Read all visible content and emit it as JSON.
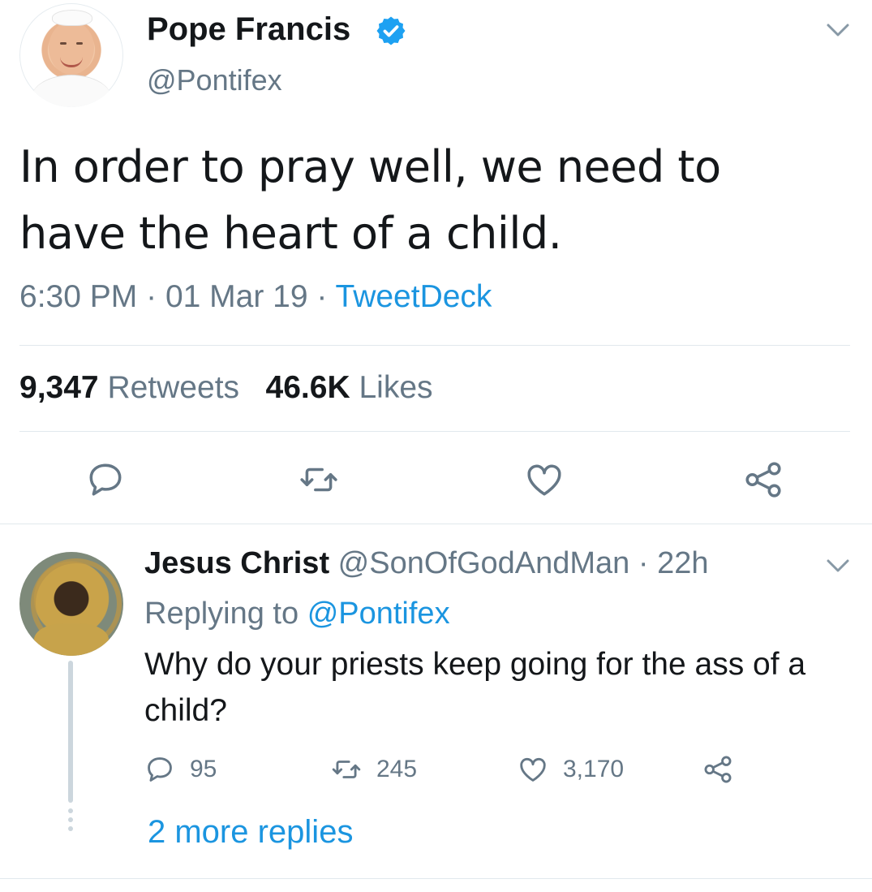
{
  "tweet": {
    "author_name": "Pope Francis",
    "handle": "@Pontifex",
    "text": "In order to pray well, we need to have the heart of a child.",
    "time": "6:30 PM",
    "date": "01 Mar 19",
    "source": "TweetDeck",
    "separator": "·",
    "retweet_count": "9,347",
    "retweet_label": "Retweets",
    "like_count": "46.6K",
    "like_label": "Likes"
  },
  "reply": {
    "author_name": "Jesus Christ",
    "handle": "@SonOfGodAndMan",
    "age": "22h",
    "separator": "·",
    "replying_prefix": "Replying to",
    "replying_handle": "@Pontifex",
    "text": "Why do your priests keep going for the ass of a child?",
    "reply_count": "95",
    "retweet_count": "245",
    "like_count": "3,170",
    "more_replies": "2 more replies"
  },
  "colors": {
    "link_blue": "#1b95e0",
    "secondary_text": "#657786",
    "primary_text": "#14171a",
    "divider": "#e1e8ed",
    "verified_badge": "#1da1f2"
  },
  "icons": {
    "verified": "verified-badge-icon",
    "menu": "chevron-down-icon",
    "reply": "speech-bubble-icon",
    "retweet": "retweet-arrows-icon",
    "like": "heart-icon",
    "share": "share-nodes-icon"
  }
}
